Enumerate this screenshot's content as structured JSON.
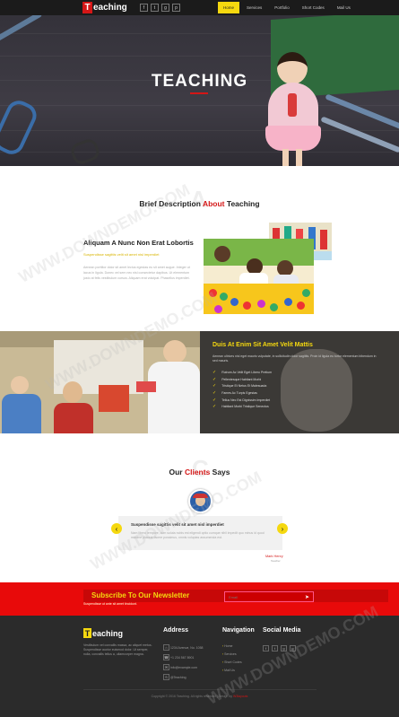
{
  "header": {
    "logo_letter": "T",
    "logo_rest": "eaching",
    "social_icons": [
      "facebook-icon",
      "twitter-icon",
      "google-plus-icon",
      "pinterest-icon"
    ],
    "social_glyphs": [
      "f",
      "t",
      "g",
      "p"
    ],
    "nav": [
      {
        "label": "Home",
        "active": true
      },
      {
        "label": "Services",
        "active": false
      },
      {
        "label": "Portfolio",
        "active": false
      },
      {
        "label": "Short Codes",
        "active": false
      },
      {
        "label": "Mail Us",
        "active": false
      }
    ]
  },
  "hero": {
    "title": "TEACHING"
  },
  "brief": {
    "heading_pre": "Brief Description ",
    "heading_accent": "About",
    "heading_post": " Teaching",
    "ghost_letter": "A",
    "subtitle": "Aliquam A Nunc Non Erat Lobortis",
    "yellow_text": "Suspendisse sagittis velit sit amet nisl imperdiet",
    "body": "Aenean porttitor dolor sit amet lectus egestas eu sit amet augue. Integer ut lacus in ligula. Donec vel sem nec nisl consectetur dapibus. Ut elementum justo at felis vestibulum cursus. Aliquam erat volutpat. Phasellus imperdiet."
  },
  "feature": {
    "title": "Duis At Enim Sit Amet Velit Mattis",
    "text": "Aenean ultrices nisl eget mauris vulputate, in sollicitudin dolor sagittis. Proin id ligula eu tortor elementum bibendum in sed mauris.",
    "list": [
      "Rutrum Ac Velit Eget Libero Pretium",
      "Pellentesque Habitant Morbi",
      "Tristique Et Netus Et Malesuada",
      "Fames Ac Turpis Egestas",
      "Tellus Nec Est Dignissim Imperdiet",
      "Habitant Morbi Tristique Senectus"
    ]
  },
  "clients": {
    "heading_pre": "Our ",
    "heading_accent": "Clients",
    "heading_post": " Says",
    "ghost_letter": "C",
    "testimonial_title": "Suspendisse sagittis velit sit amet nisl imperdiet",
    "testimonial_text": "Nam libero tempore, cum soluta nobis est eligendi optio cumque nihil impedit quo minus id quod maxime placeat facere possimus, omnis voluptas assumenda est.",
    "author": "Mark Henry",
    "author_role": "Teacher",
    "prev_glyph": "‹",
    "next_glyph": "›"
  },
  "newsletter": {
    "title": "Subscribe To Our Newsletter",
    "subtitle": "Suspendisse ut ante sit amet tincidunt.",
    "placeholder": "Email",
    "submit_glyph": "➤"
  },
  "footer": {
    "logo_letter": "T",
    "logo_rest": "eaching",
    "about": "Vestibulum vel convallis massa, ac aliquet metus. Suspendisse auctor euismod dolor. Ut semper, nulla, convallis tellus a, ullamcorper magna.",
    "address_heading": "Address",
    "address_lines": [
      "1234 Avenue, No. 1058",
      "+1 234 567 8901",
      "info@example.com",
      "@Teaching"
    ],
    "navigation_heading": "Navigation",
    "navigation_links": [
      "Home",
      "Services",
      "Short Codes",
      "Mail Us"
    ],
    "social_heading": "Social Media",
    "social_glyphs": [
      "f",
      "t",
      "g",
      "p"
    ],
    "copyright_pre": "Copyright © 2016 Teaching. All rights reserved | Design by ",
    "copyright_link": "W3layouts"
  },
  "watermark": "WWW.DOWNDEMO.COM",
  "colors": {
    "accent_yellow": "#f5d80f",
    "accent_red": "#d41616",
    "footer_bg": "#2b2b2b"
  }
}
